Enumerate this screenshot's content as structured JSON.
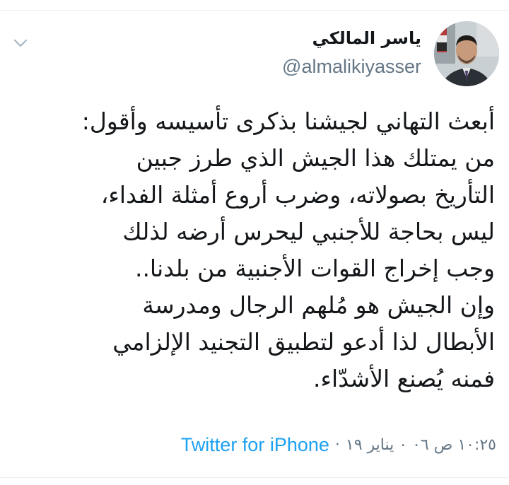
{
  "tweet": {
    "author": {
      "display_name": "ياسر المالكي",
      "handle": "@almalikiyasser"
    },
    "lines": [
      "أبعث التهاني لجيشنا بذكرى تأسيسه وأقول:",
      "من يمتلك هذا الجيش الذي طرز جبين",
      "التأريخ بصولاته، وضرب أروع أمثلة الفداء،",
      "ليس بحاجة للأجنبي ليحرس أرضه لذلك",
      "وجب إخراج القوات الأجنبية من بلدنا..",
      "وإن الجيش هو مُلهم الرجال ومدرسة",
      "الأبطال لذا أدعو لتطبيق التجنيد الإلزامي",
      "فمنه يُصنع الأشدّاء."
    ],
    "timestamp": "١٠:٢٥ ص ٠٦ ٠ يناير ١٩",
    "separator": "·",
    "source": "Twitter for iPhone"
  },
  "icons": {
    "menu": "chevron-down-icon",
    "avatar": "avatar"
  },
  "colors": {
    "text": "#14171a",
    "secondary": "#657786",
    "link": "#1da1f2"
  }
}
